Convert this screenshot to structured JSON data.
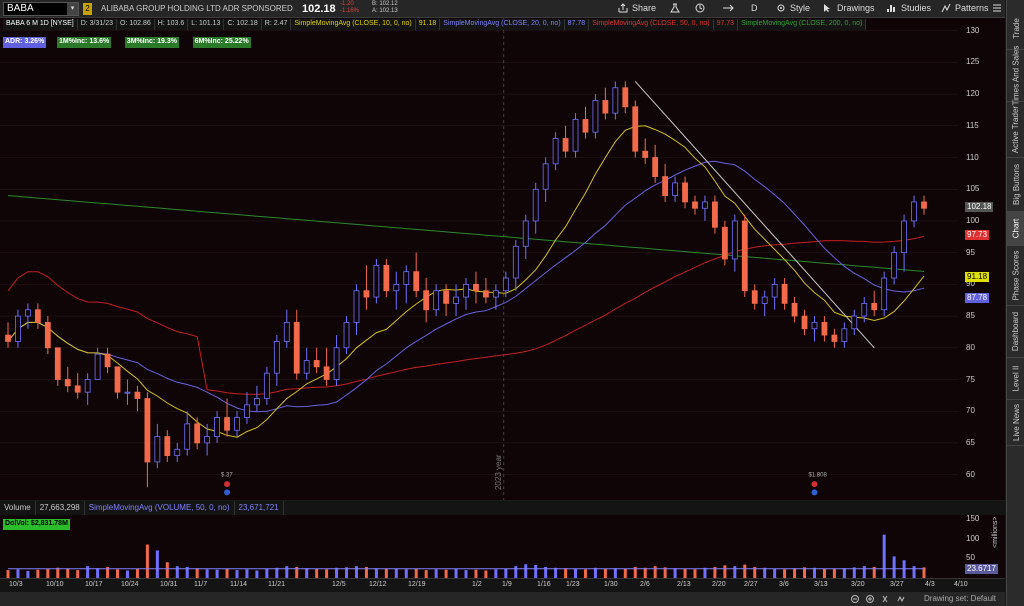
{
  "header": {
    "symbol": "BABA",
    "symbol_badge": "2",
    "company": "ALIBABA GROUP HOLDING LTD ADR SPONSORED",
    "last": "102.18",
    "change": "-1.20",
    "change_pct": "-1.16%",
    "bid": "B: 102.12",
    "ask": "A: 102.13"
  },
  "toolbar": {
    "share": "Share",
    "period": "D",
    "style": "Style",
    "drawings": "Drawings",
    "studies": "Studies",
    "patterns": "Patterns"
  },
  "study_header": [
    {
      "text": "BABA 6 M 1D [NYSE]",
      "color": "#ffffff"
    },
    {
      "text": "D: 3/31/23",
      "color": "#cccccc"
    },
    {
      "text": "O: 102.86",
      "color": "#cccccc"
    },
    {
      "text": "H: 103.6",
      "color": "#cccccc"
    },
    {
      "text": "L: 101.13",
      "color": "#cccccc"
    },
    {
      "text": "C: 102.18",
      "color": "#cccccc"
    },
    {
      "text": "R: 2.47",
      "color": "#cccccc"
    },
    {
      "text": "SimpleMovingAvg (CLOSE, 10, 0, no)",
      "color": "#e0d000"
    },
    {
      "text": "91.18",
      "color": "#e0d000"
    },
    {
      "text": "SimpleMovingAvg (CLOSE, 20, 0, no)",
      "color": "#8080ff"
    },
    {
      "text": "87.78",
      "color": "#8080ff"
    },
    {
      "text": "SimpleMovingAvg (CLOSE, 50, 0, no)",
      "color": "#e03030"
    },
    {
      "text": "97.73",
      "color": "#e03030"
    },
    {
      "text": "SimpleMovingAvg (CLOSE, 200, 0, no)",
      "color": "#30a030"
    }
  ],
  "chips": [
    {
      "text": "ADR: 3.26%",
      "bg": "#6060e0"
    },
    {
      "text": "1M%Inc: 13.6%",
      "bg": "#2a7a2a"
    },
    {
      "text": "3M%Inc: 19.3%",
      "bg": "#2a7a2a"
    },
    {
      "text": "6M%Inc: 25.22%",
      "bg": "#2a7a2a"
    }
  ],
  "price_axis": [
    "130",
    "125",
    "120",
    "115",
    "110",
    "105",
    "100",
    "95",
    "90",
    "85",
    "80",
    "75",
    "70",
    "65",
    "60"
  ],
  "price_tags": [
    {
      "text": "102.18",
      "bg": "#555555",
      "fg": "#ffffff",
      "price": 102.18
    },
    {
      "text": "97.73",
      "bg": "#e03030",
      "fg": "#ffffff",
      "price": 97.73
    },
    {
      "text": "91.18",
      "bg": "#e0e000",
      "fg": "#000000",
      "price": 91.18
    },
    {
      "text": "87.78",
      "bg": "#6060e0",
      "fg": "#ffffff",
      "price": 87.78
    }
  ],
  "year_label": "2023 year",
  "events": [
    {
      "date": "11/18",
      "label": "$.37"
    },
    {
      "date": "2/23",
      "label": "$1.808"
    }
  ],
  "volume_header": [
    "Volume",
    "27,663,298",
    "SimpleMovingAvg (VOLUME, 50, 0, no)",
    "23,671,721"
  ],
  "dolvol": "DolVol: $2,831.78M",
  "volume_axis": [
    "150",
    "100",
    "50"
  ],
  "volume_tag": "23.6717",
  "volume_unit": "<millions>",
  "x_axis": [
    "10/3",
    "10/10",
    "10/17",
    "10/24",
    "10/31",
    "11/7",
    "11/14",
    "11/21",
    "12/5",
    "12/12",
    "12/19",
    "1/2",
    "1/9",
    "1/16",
    "1/23",
    "1/30",
    "2/6",
    "2/13",
    "2/20",
    "2/27",
    "3/6",
    "3/13",
    "3/20",
    "3/27",
    "4/3",
    "4/10"
  ],
  "sidebar": [
    "Trade",
    "Times And Sales",
    "Active Trader",
    "Big Buttons",
    "Chart",
    "Phase Scores",
    "Dashboard",
    "Level II",
    "Live News"
  ],
  "active_tab": "Chart",
  "status": "Drawing set: Default",
  "colors": {
    "up": "#7070ff",
    "down": "#f26a4a",
    "sma10": "#d4c020",
    "sma20": "#6a62e0",
    "sma50": "#c42020",
    "sma200": "#2a8a2a"
  },
  "chart_data": {
    "type": "candlestick",
    "ylim": [
      56,
      132
    ],
    "candles": [
      [
        82,
        84,
        80,
        81
      ],
      [
        81,
        86,
        80,
        85
      ],
      [
        85,
        87,
        83,
        86
      ],
      [
        86,
        87,
        83,
        84
      ],
      [
        84,
        85,
        79,
        80
      ],
      [
        80,
        80,
        74,
        75
      ],
      [
        75,
        77,
        73,
        74
      ],
      [
        74,
        76,
        72,
        73
      ],
      [
        73,
        76,
        71,
        75
      ],
      [
        75,
        80,
        75,
        79
      ],
      [
        79,
        80,
        76,
        77
      ],
      [
        77,
        77,
        72,
        73
      ],
      [
        73,
        75,
        71,
        73
      ],
      [
        73,
        74,
        70,
        72
      ],
      [
        72,
        73,
        58,
        62
      ],
      [
        62,
        68,
        61,
        66
      ],
      [
        66,
        67,
        62,
        63
      ],
      [
        63,
        65,
        62,
        64
      ],
      [
        64,
        70,
        63,
        68
      ],
      [
        68,
        69,
        64,
        65
      ],
      [
        65,
        68,
        63,
        66
      ],
      [
        66,
        70,
        65,
        69
      ],
      [
        69,
        72,
        66,
        67
      ],
      [
        67,
        70,
        66,
        69
      ],
      [
        69,
        73,
        68,
        71
      ],
      [
        71,
        74,
        70,
        72
      ],
      [
        72,
        77,
        71,
        76
      ],
      [
        76,
        82,
        74,
        81
      ],
      [
        81,
        86,
        80,
        84
      ],
      [
        84,
        86,
        75,
        76
      ],
      [
        76,
        80,
        75,
        78
      ],
      [
        78,
        80,
        76,
        77
      ],
      [
        77,
        80,
        74,
        75
      ],
      [
        75,
        82,
        74,
        80
      ],
      [
        80,
        85,
        79,
        84
      ],
      [
        84,
        90,
        82,
        89
      ],
      [
        89,
        93,
        86,
        88
      ],
      [
        88,
        94,
        87,
        93
      ],
      [
        93,
        94,
        88,
        89
      ],
      [
        89,
        92,
        86,
        90
      ],
      [
        90,
        93,
        87,
        92
      ],
      [
        92,
        95,
        88,
        89
      ],
      [
        89,
        91,
        84,
        86
      ],
      [
        86,
        90,
        85,
        89
      ],
      [
        89,
        90,
        85,
        87
      ],
      [
        87,
        90,
        85,
        88
      ],
      [
        88,
        91,
        86,
        90
      ],
      [
        90,
        92,
        87,
        89
      ],
      [
        89,
        91,
        87,
        88
      ],
      [
        88,
        90,
        86,
        89
      ],
      [
        89,
        92,
        88,
        91
      ],
      [
        91,
        97,
        89,
        96
      ],
      [
        96,
        101,
        94,
        100
      ],
      [
        100,
        106,
        98,
        105
      ],
      [
        105,
        110,
        103,
        109
      ],
      [
        109,
        114,
        108,
        113
      ],
      [
        113,
        115,
        110,
        111
      ],
      [
        111,
        117,
        110,
        116
      ],
      [
        116,
        118,
        113,
        114
      ],
      [
        114,
        120,
        113,
        119
      ],
      [
        119,
        121,
        116,
        117
      ],
      [
        117,
        122,
        116,
        121
      ],
      [
        121,
        122,
        117,
        118
      ],
      [
        118,
        119,
        110,
        111
      ],
      [
        111,
        113,
        109,
        110
      ],
      [
        110,
        112,
        106,
        107
      ],
      [
        107,
        109,
        103,
        104
      ],
      [
        104,
        107,
        103,
        106
      ],
      [
        106,
        107,
        102,
        103
      ],
      [
        103,
        104,
        101,
        102
      ],
      [
        102,
        104,
        100,
        103
      ],
      [
        103,
        104,
        98,
        99
      ],
      [
        99,
        100,
        93,
        94
      ],
      [
        94,
        101,
        92,
        100
      ],
      [
        100,
        101,
        88,
        89
      ],
      [
        89,
        90,
        86,
        87
      ],
      [
        87,
        89,
        85,
        88
      ],
      [
        88,
        91,
        86,
        90
      ],
      [
        90,
        91,
        86,
        87
      ],
      [
        87,
        88,
        84,
        85
      ],
      [
        85,
        86,
        82,
        83
      ],
      [
        83,
        85,
        81,
        84
      ],
      [
        84,
        85,
        81,
        82
      ],
      [
        82,
        83,
        80,
        81
      ],
      [
        81,
        84,
        80,
        83
      ],
      [
        83,
        86,
        82,
        85
      ],
      [
        85,
        88,
        84,
        87
      ],
      [
        87,
        89,
        85,
        86
      ],
      [
        86,
        92,
        85,
        91
      ],
      [
        91,
        96,
        90,
        95
      ],
      [
        95,
        101,
        92,
        100
      ],
      [
        100,
        104,
        99,
        103
      ],
      [
        103,
        104,
        101,
        102
      ]
    ],
    "volume": [
      20,
      22,
      18,
      21,
      24,
      26,
      23,
      20,
      30,
      25,
      28,
      22,
      19,
      24,
      85,
      70,
      40,
      30,
      28,
      25,
      22,
      21,
      24,
      20,
      22,
      19,
      23,
      26,
      30,
      28,
      25,
      24,
      22,
      26,
      27,
      30,
      28,
      25,
      24,
      23,
      22,
      24,
      20,
      22,
      21,
      23,
      20,
      21,
      19,
      22,
      24,
      30,
      35,
      33,
      28,
      26,
      25,
      24,
      22,
      26,
      24,
      25,
      23,
      28,
      26,
      30,
      27,
      25,
      24,
      22,
      26,
      28,
      32,
      30,
      34,
      28,
      26,
      24,
      22,
      25,
      27,
      26,
      24,
      23,
      25,
      27,
      30,
      28,
      110,
      55,
      45,
      30,
      27
    ],
    "trendline": {
      "from": [
        93,
        122
      ],
      "to": [
        143,
        80
      ]
    }
  }
}
